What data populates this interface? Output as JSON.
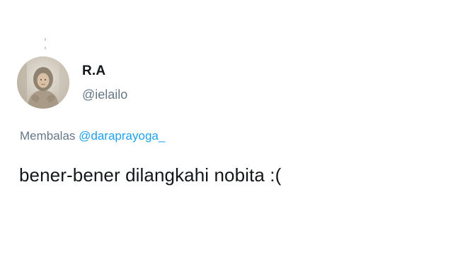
{
  "thread": {
    "connector_color": "#c4cbd1"
  },
  "author": {
    "display_name": "R.A",
    "handle": "@ielailo",
    "avatar_icon": "profile-photo"
  },
  "reply": {
    "prefix": "Membalas",
    "target": "@daraprayoga_"
  },
  "tweet": {
    "text": "bener-bener dilangkahi nobita :("
  },
  "colors": {
    "text_primary": "#14171a",
    "text_secondary": "#657786",
    "link": "#1da1f2",
    "background": "#ffffff"
  }
}
